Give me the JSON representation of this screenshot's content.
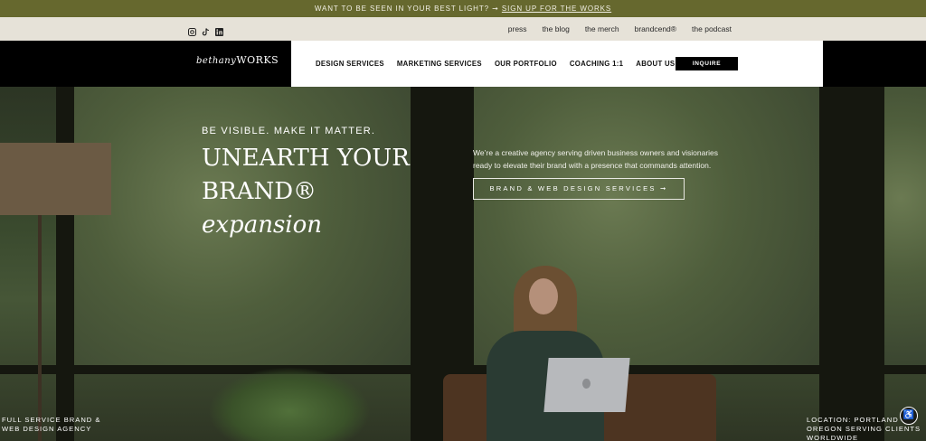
{
  "announcement": {
    "prefix": "WANT TO BE SEEN IN YOUR BEST LIGHT? ➞ ",
    "link": "SIGN UP FOR THE WORKS"
  },
  "social": [
    "instagram-icon",
    "tiktok-icon",
    "linkedin-icon"
  ],
  "top_links": [
    "press",
    "the blog",
    "the merch",
    "brandcend®",
    "the podcast"
  ],
  "logo": {
    "script": "bethany",
    "caps": "WORKS"
  },
  "nav": [
    "DESIGN SERVICES",
    "MARKETING SERVICES",
    "OUR PORTFOLIO",
    "COACHING 1:1",
    "ABOUT US"
  ],
  "inquire": "INQUIRE",
  "hero": {
    "tagline": "BE VISIBLE. MAKE IT MATTER.",
    "headline_line1": "UNEARTH YOUR",
    "headline_line2_plain": "BRAND® ",
    "headline_line2_italic": "expansion",
    "description": "We’re a creative agency serving driven business owners and visionaries ready to elevate their brand with a presence that commands attention.",
    "cta": "BRAND & WEB DESIGN SERVICES ➞"
  },
  "footer": {
    "left": "FULL SERVICE BRAND & WEB DESIGN AGENCY",
    "right": "LOCATION: PORTLAND OREGON SERVING CLIENTS WORLDWIDE"
  },
  "colors": {
    "olive": "#66682e",
    "cream": "#e6e2d8",
    "black": "#000000"
  }
}
